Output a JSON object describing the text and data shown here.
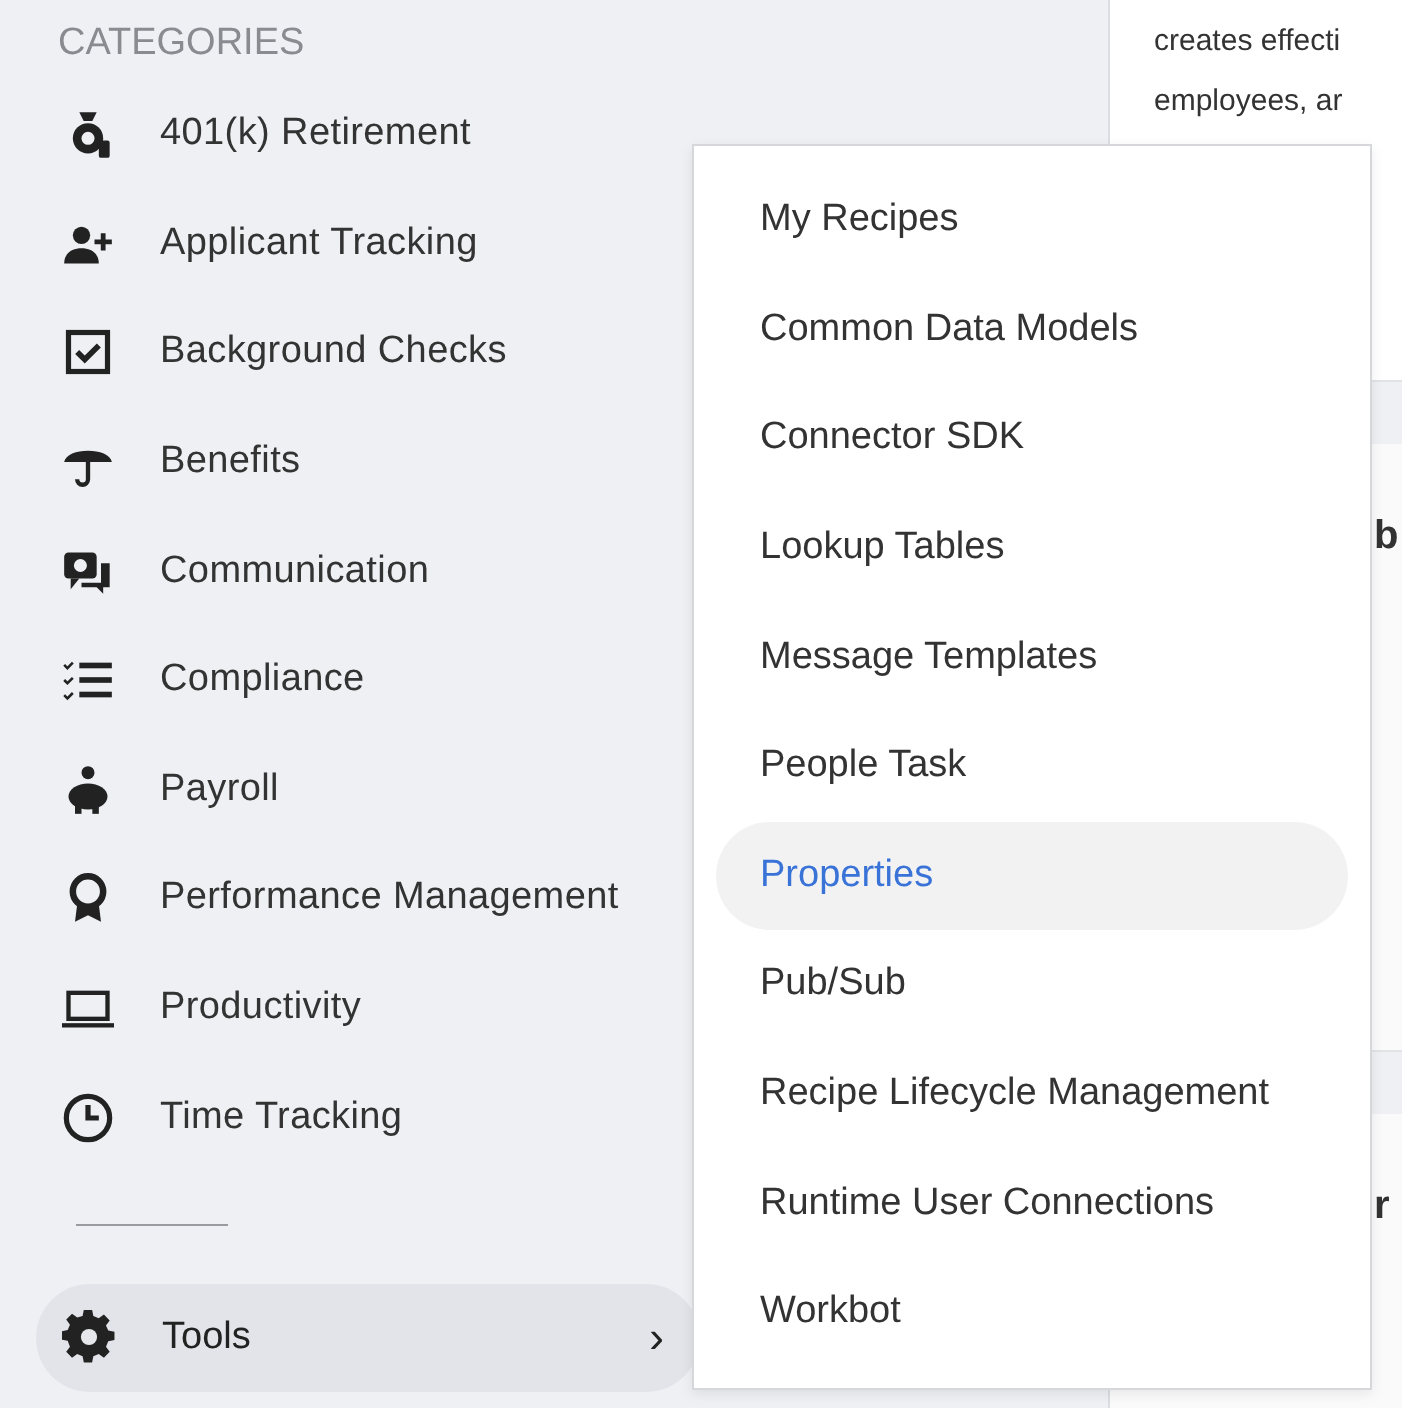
{
  "sidebar": {
    "heading": "CATEGORIES",
    "items": [
      {
        "label": "401(k) Retirement"
      },
      {
        "label": "Applicant Tracking"
      },
      {
        "label": "Background Checks"
      },
      {
        "label": "Benefits"
      },
      {
        "label": "Communication"
      },
      {
        "label": "Compliance"
      },
      {
        "label": "Payroll"
      },
      {
        "label": "Performance Management"
      },
      {
        "label": "Productivity"
      },
      {
        "label": "Time Tracking"
      }
    ],
    "tools": {
      "label": "Tools",
      "chevron": "›",
      "selected": true
    }
  },
  "content": {
    "description_lines": [
      "creates effecti",
      "employees, ar"
    ],
    "partial_headings": [
      "b",
      "r"
    ]
  },
  "tools_menu": {
    "items": [
      {
        "label": "My Recipes",
        "selected": false
      },
      {
        "label": "Common Data Models",
        "selected": false
      },
      {
        "label": "Connector SDK",
        "selected": false
      },
      {
        "label": "Lookup Tables",
        "selected": false
      },
      {
        "label": "Message Templates",
        "selected": false
      },
      {
        "label": "People Task",
        "selected": false
      },
      {
        "label": "Properties",
        "selected": true
      },
      {
        "label": "Pub/Sub",
        "selected": false
      },
      {
        "label": "Recipe Lifecycle Management",
        "selected": false
      },
      {
        "label": "Runtime User Connections",
        "selected": false
      },
      {
        "label": "Workbot",
        "selected": false
      }
    ]
  }
}
